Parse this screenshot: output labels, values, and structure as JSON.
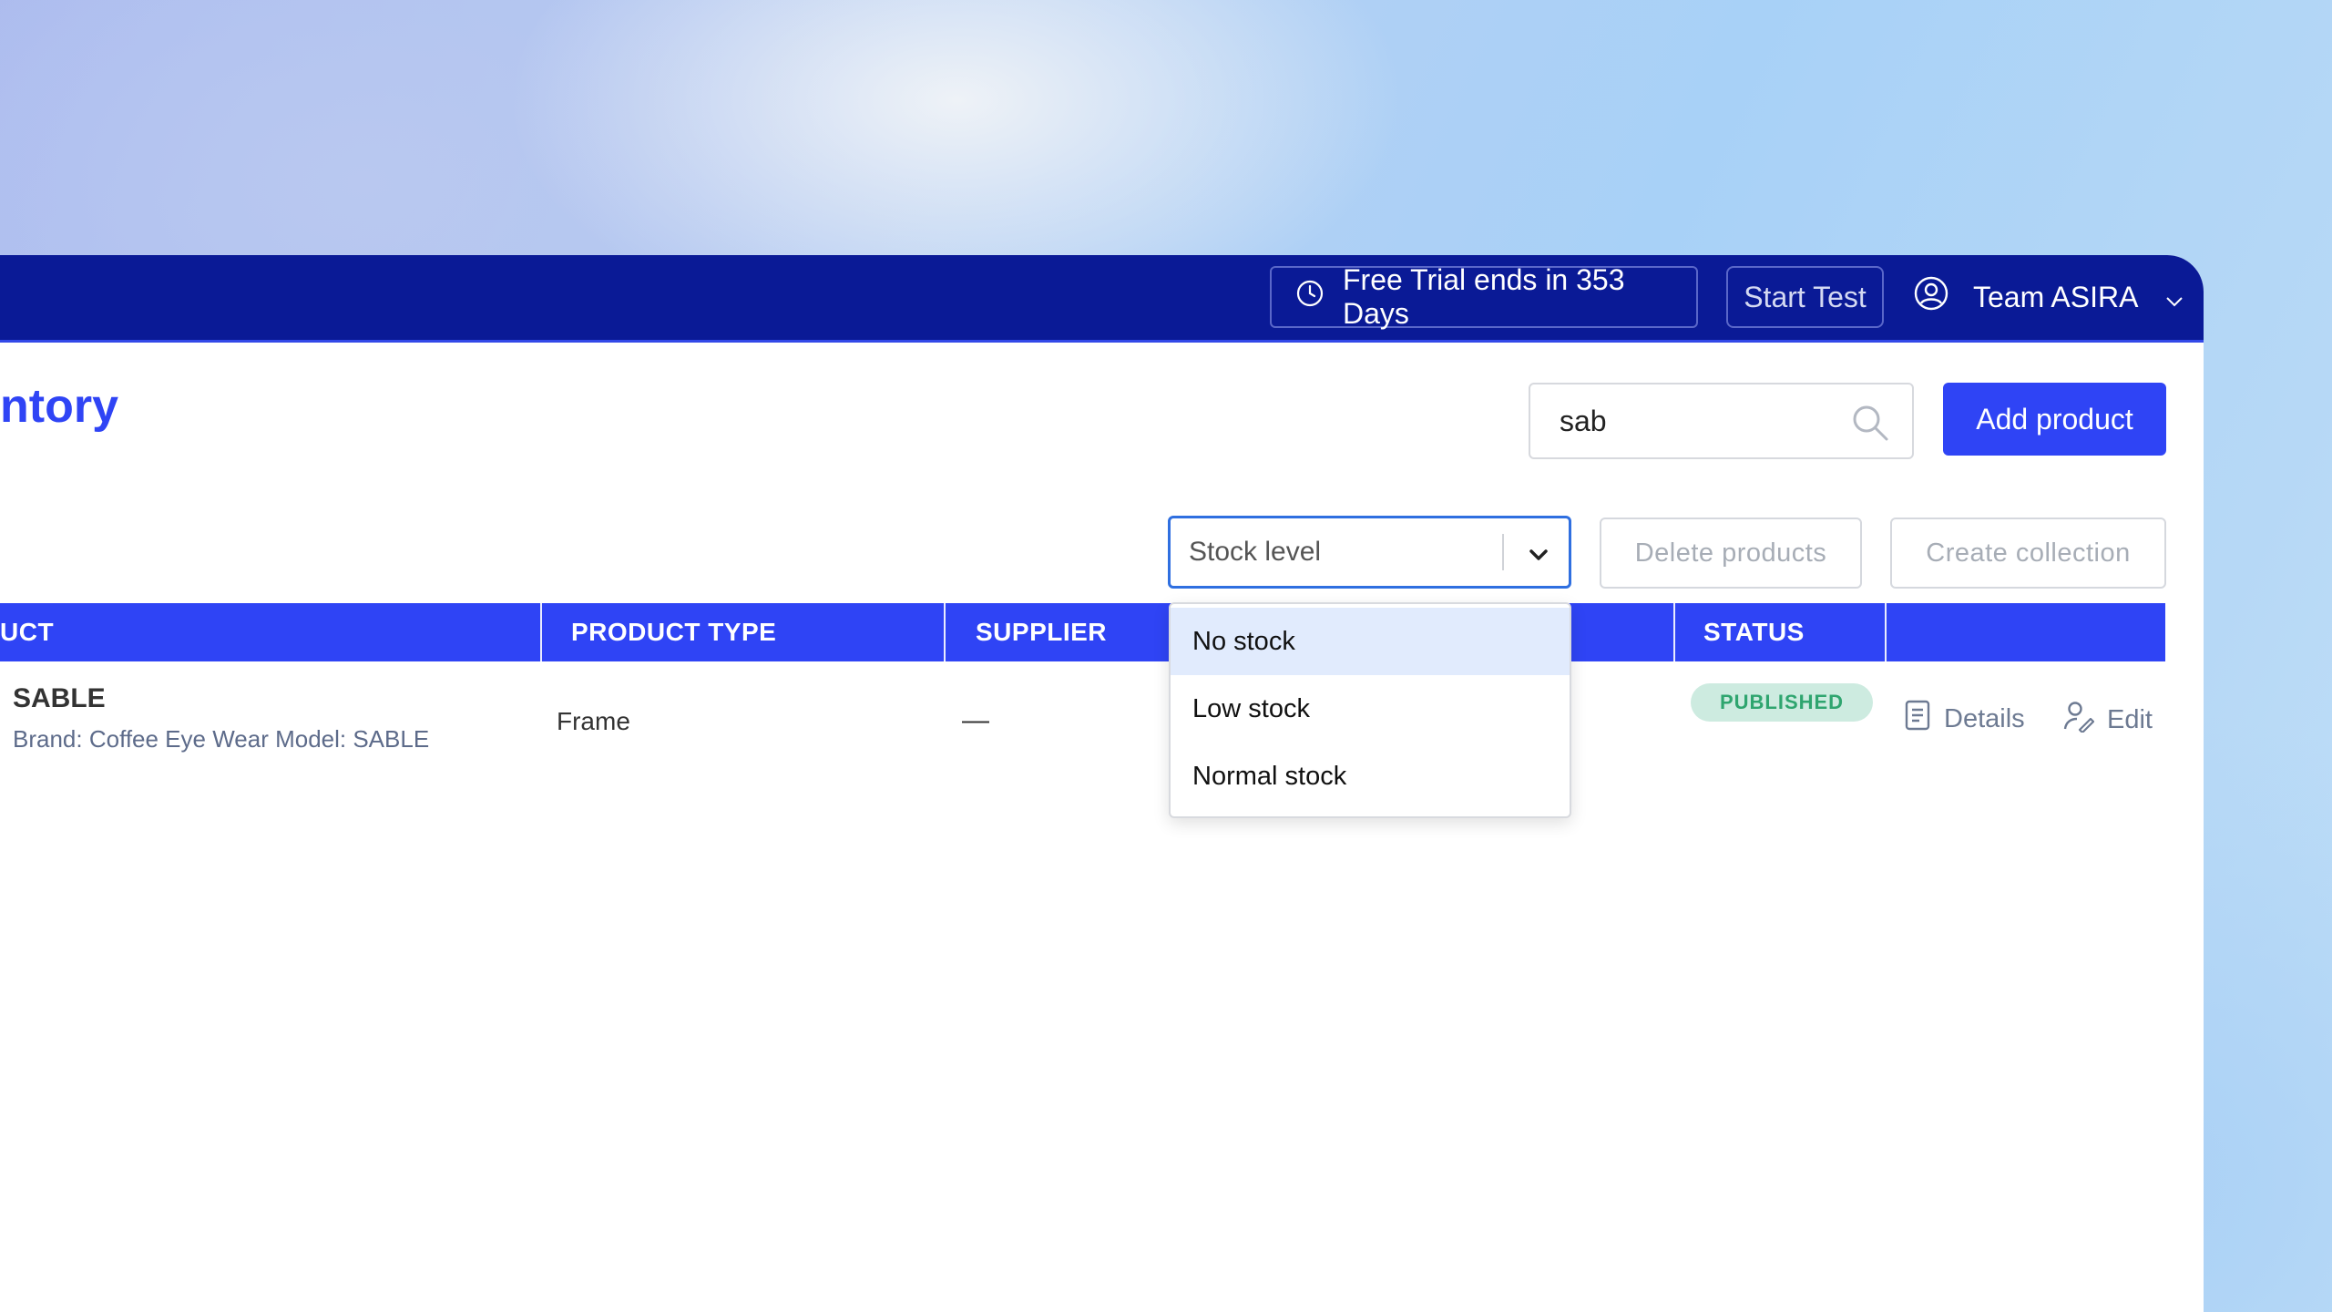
{
  "topbar": {
    "trial_text": "Free Trial ends in 353 Days",
    "start_test_label": "Start Test",
    "team_name": "Team ASIRA"
  },
  "page": {
    "title": "ntory"
  },
  "search": {
    "value": "sab"
  },
  "toolbar": {
    "add_product_label": "Add product",
    "stock_select_value": "Stock level",
    "delete_label": "Delete products",
    "collection_label": "Create collection"
  },
  "table": {
    "headers": [
      "UCT",
      "PRODUCT TYPE",
      "SUPPLIER",
      "STATUS"
    ],
    "rows": [
      {
        "name": "SABLE",
        "subtitle": "Brand: Coffee Eye Wear Model: SABLE",
        "product_type": "Frame",
        "supplier": "—",
        "status": "PUBLISHED",
        "details_label": "Details",
        "edit_label": "Edit"
      }
    ]
  },
  "dropdown": {
    "options": [
      "No stock",
      "Low stock",
      "Normal stock"
    ],
    "highlighted_index": 0
  },
  "colors": {
    "topbar": "#0a1a96",
    "accent": "#2f44f5",
    "status_bg": "#cdebe0",
    "status_text": "#2fa56f"
  }
}
